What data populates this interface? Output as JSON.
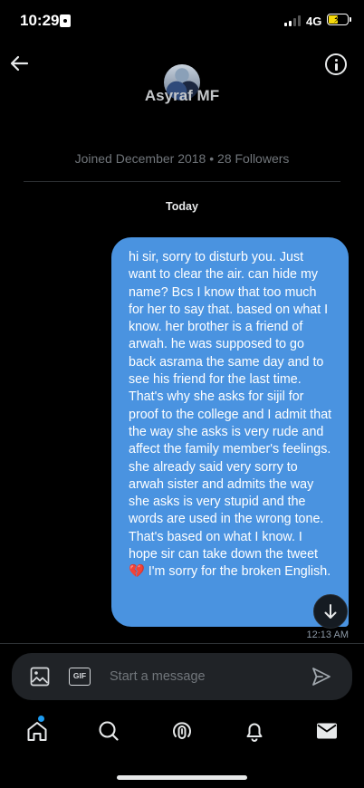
{
  "status_bar": {
    "time": "10:29",
    "network": "4G",
    "battery_level": 0.55,
    "signal_bars_active": 2
  },
  "header": {
    "profile_name": "Asyraf MF",
    "joined": "Joined December 2018",
    "separator": "•",
    "followers": "28 Followers",
    "back_icon": "arrow-left-icon",
    "info_icon": "info-circle-icon"
  },
  "conversation": {
    "day_label": "Today",
    "messages": [
      {
        "direction": "outgoing",
        "text_before_emoji": "hi sir, sorry to disturb you. Just want to clear the air. can hide my name? Bcs I know that too much for her to say that. based on what I know. her brother is a friend of arwah. he was supposed to go back asrama the same day and to see his friend for the last time. That's why she asks for sijil for proof to the college and I admit that the way she asks is very rude and affect the family member's feelings. she already said very sorry to arwah sister and admits the way she asks is very stupid and the words are used in the wrong tone. That's based on what I know. I hope sir can take down the tweet",
        "emoji": "💔",
        "text_after_emoji": " I'm sorry for the broken English.",
        "time": "12:13 AM"
      }
    ]
  },
  "composer": {
    "placeholder": "Start a message",
    "gif_label": "GIF"
  },
  "nav": {
    "items": [
      "home-icon",
      "search-icon",
      "spaces-icon",
      "notifications-icon",
      "messages-icon"
    ]
  },
  "colors": {
    "bubble": "#4a93e0",
    "accent": "#1d9bf0",
    "background": "#000000",
    "battery": "#f5d90a"
  }
}
